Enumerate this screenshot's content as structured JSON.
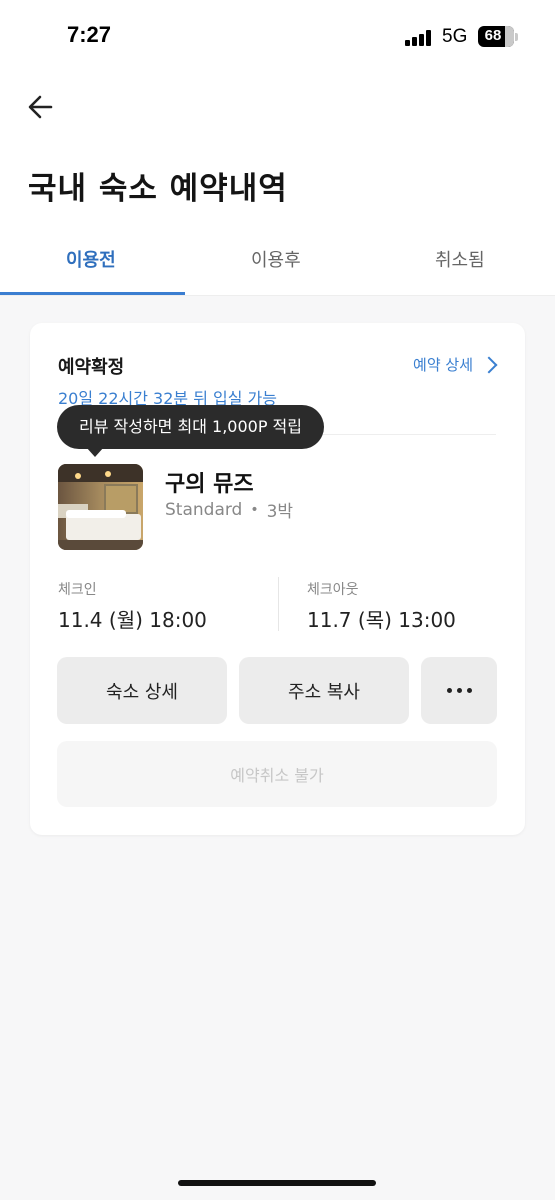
{
  "status_bar": {
    "time": "7:27",
    "network": "5G",
    "battery": "68"
  },
  "header": {
    "title": "국내 숙소 예약내역"
  },
  "tabs": [
    {
      "label": "이용전",
      "active": true
    },
    {
      "label": "이용후",
      "active": false
    },
    {
      "label": "취소됨",
      "active": false
    }
  ],
  "reservation": {
    "status": "예약확정",
    "countdown": "20일 22시간 32분 뒤 입실 가능",
    "detail_link": "예약 상세",
    "tooltip": "리뷰 작성하면 최대 1,000P 적립",
    "hotel_name": "구의 뮤즈",
    "room_type": "Standard",
    "nights": "3박",
    "checkin_label": "체크인",
    "checkin_value": "11.4 (월) 18:00",
    "checkout_label": "체크아웃",
    "checkout_value": "11.7 (목) 13:00",
    "buttons": {
      "property_detail": "숙소 상세",
      "copy_address": "주소 복사"
    },
    "cancel_label": "예약취소 불가"
  },
  "colors": {
    "accent": "#3b7ed1",
    "tooltip_bg": "#2b2b2b",
    "button_bg": "#ececec",
    "disabled_text": "#c7c7c7"
  }
}
